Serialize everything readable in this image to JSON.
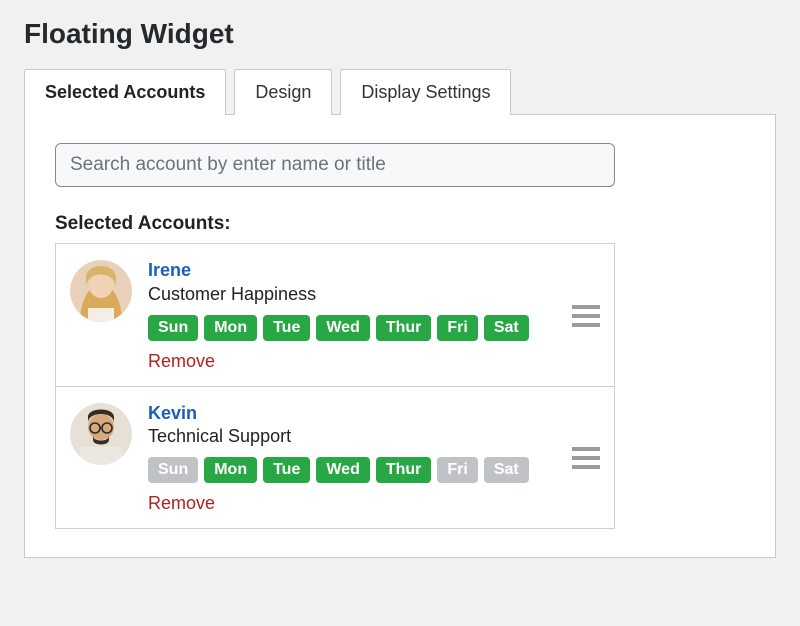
{
  "page_title": "Floating Widget",
  "tabs": [
    {
      "label": "Selected Accounts",
      "active": true
    },
    {
      "label": "Design",
      "active": false
    },
    {
      "label": "Display Settings",
      "active": false
    }
  ],
  "search": {
    "placeholder": "Search account by enter name or title",
    "value": ""
  },
  "section_label": "Selected Accounts:",
  "remove_label": "Remove",
  "colors": {
    "day_active": "#28a745",
    "day_inactive": "#c0c3c6",
    "link": "#1a5fbf",
    "danger": "#b32020"
  },
  "accounts": [
    {
      "name": "Irene",
      "title": "Customer Happiness",
      "avatar": "woman-blonde",
      "days": [
        {
          "label": "Sun",
          "active": true
        },
        {
          "label": "Mon",
          "active": true
        },
        {
          "label": "Tue",
          "active": true
        },
        {
          "label": "Wed",
          "active": true
        },
        {
          "label": "Thur",
          "active": true
        },
        {
          "label": "Fri",
          "active": true
        },
        {
          "label": "Sat",
          "active": true
        }
      ]
    },
    {
      "name": "Kevin",
      "title": "Technical Support",
      "avatar": "man-glasses",
      "days": [
        {
          "label": "Sun",
          "active": false
        },
        {
          "label": "Mon",
          "active": true
        },
        {
          "label": "Tue",
          "active": true
        },
        {
          "label": "Wed",
          "active": true
        },
        {
          "label": "Thur",
          "active": true
        },
        {
          "label": "Fri",
          "active": false
        },
        {
          "label": "Sat",
          "active": false
        }
      ]
    }
  ]
}
